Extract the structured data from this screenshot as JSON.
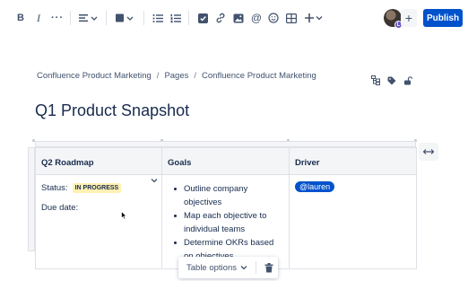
{
  "toolbar": {
    "bold": "B",
    "italic": "I",
    "more": "···",
    "mention": "@",
    "publish_label": "Publish",
    "invite": "+",
    "avatar_badge": "L",
    "icons": [
      "bold-icon",
      "italic-icon",
      "more-formatting-icon",
      "align-icon",
      "text-color-icon",
      "bullet-list-icon",
      "numbered-list-icon",
      "task-icon",
      "link-icon",
      "image-icon",
      "mention-icon",
      "emoji-icon",
      "table-icon",
      "insert-plus-icon"
    ],
    "text_color": "#42526e"
  },
  "breadcrumb": {
    "items": [
      "Confluence Product Marketing",
      "Pages",
      "Confluence Product Marketing"
    ],
    "separator": "/"
  },
  "page_icons": [
    "hierarchy-icon",
    "tag-icon",
    "lock-icon"
  ],
  "title": "Q1 Product Snapshot",
  "table": {
    "headers": [
      "Q2 Roadmap",
      "Goals",
      "Driver"
    ],
    "roadmap": {
      "status_label": "Status:",
      "status_value": "IN PROGRESS",
      "due_label": "Due date:"
    },
    "goals": [
      "Outline company objectives",
      "Map each objective to individual teams",
      "Determine OKRs based on objectives"
    ],
    "driver": "@lauren"
  },
  "table_options": {
    "label": "Table options"
  },
  "colors": {
    "accent": "#0052cc",
    "lozenge_bg": "#fff0b3",
    "header_bg": "#f4f5f7",
    "border": "#dfe1e6"
  }
}
